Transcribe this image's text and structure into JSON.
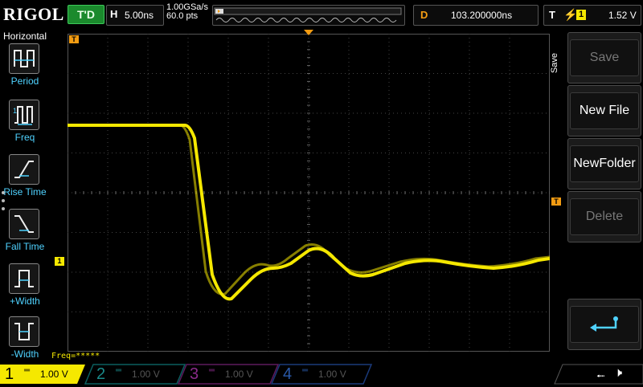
{
  "header": {
    "logo": "RIGOL",
    "run_status": "T'D",
    "timebase_key": "H",
    "timebase_value": "5.00ns",
    "sample_rate": "1.00GSa/s",
    "points": "60.0 pts",
    "delay_key": "D",
    "delay_value": "103.200000ns",
    "trigger_key": "T",
    "trigger_source": "1",
    "trigger_level": "1.52 V"
  },
  "left_menu": {
    "title": "Horizontal",
    "items": [
      {
        "label": "Period",
        "icon": "period-icon"
      },
      {
        "label": "Freq",
        "icon": "frequency-icon"
      },
      {
        "label": "Rise Time",
        "icon": "rise-time-icon"
      },
      {
        "label": "Fall Time",
        "icon": "fall-time-icon"
      },
      {
        "label": "+Width",
        "icon": "positive-width-icon"
      },
      {
        "label": "-Width",
        "icon": "negative-width-icon"
      }
    ]
  },
  "measurement": {
    "freq": "Freq=*****"
  },
  "right_menu": {
    "title": "Save",
    "buttons": [
      {
        "label": "Save",
        "enabled": false
      },
      {
        "label": "New File",
        "enabled": true
      },
      {
        "label": "NewFolder",
        "enabled": true
      },
      {
        "label": "Delete",
        "enabled": false
      }
    ],
    "enter_icon": "enter-icon"
  },
  "markers": {
    "channel1": "1",
    "trigger_pos_top": "T",
    "trigger_level_right": "T"
  },
  "channels": [
    {
      "num": "1",
      "coupling": "═",
      "scale": "1.00 V",
      "color": "#f5e800",
      "active": true
    },
    {
      "num": "2",
      "coupling": "═",
      "scale": "1.00 V",
      "color": "#00c4c4",
      "active": false
    },
    {
      "num": "3",
      "coupling": "═",
      "scale": "1.00 V",
      "color": "#e040e0",
      "active": false
    },
    {
      "num": "4",
      "coupling": "═",
      "scale": "1.00 V",
      "color": "#3a7cff",
      "active": false
    }
  ],
  "status": {
    "usb_icon": "usb-icon",
    "speaker_icon": "speaker-muted-icon"
  },
  "colors": {
    "trace": "#f5e800",
    "trigger_marker": "#f39c12",
    "menu_label": "#4fd2ff",
    "run_status_bg": "#1b8a2d"
  }
}
